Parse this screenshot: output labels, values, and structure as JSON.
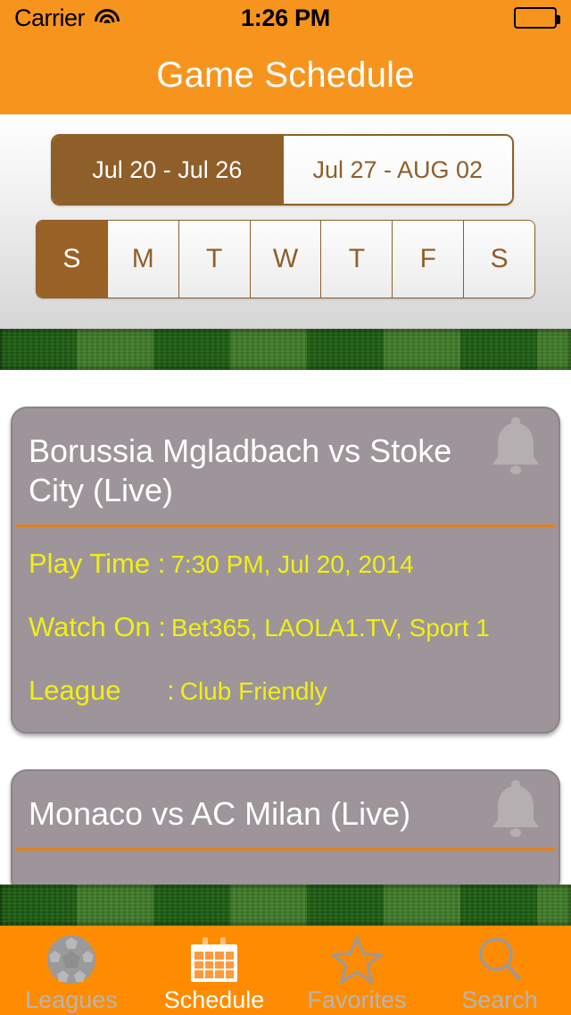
{
  "statusbar": {
    "carrier": "Carrier",
    "time": "1:26 PM",
    "wifi_icon": "wifi-icon",
    "battery_icon": "battery-full-icon"
  },
  "navbar": {
    "title": "Game Schedule"
  },
  "week_selector": {
    "options": [
      {
        "label": "Jul 20 - Jul 26",
        "selected": true
      },
      {
        "label": "Jul 27 - AUG 02",
        "selected": false
      }
    ]
  },
  "day_selector": {
    "days": [
      {
        "label": "S",
        "selected": true
      },
      {
        "label": "M",
        "selected": false
      },
      {
        "label": "T",
        "selected": false
      },
      {
        "label": "W",
        "selected": false
      },
      {
        "label": "T",
        "selected": false
      },
      {
        "label": "F",
        "selected": false
      },
      {
        "label": "S",
        "selected": false
      }
    ]
  },
  "games": [
    {
      "title": "Borussia Mgladbach vs Stoke City (Live)",
      "alarm_icon": "bell-icon",
      "play_time_label": "Play Time :",
      "play_time_value": "7:30 PM, Jul 20, 2014",
      "watch_on_label": "Watch On :",
      "watch_on_value": "Bet365, LAOLA1.TV, Sport 1",
      "league_label": "League      :",
      "league_value": "Club Friendly"
    },
    {
      "title": "Monaco vs AC Milan (Live)",
      "alarm_icon": "bell-icon"
    }
  ],
  "tabbar": {
    "items": [
      {
        "label": "Leagues",
        "icon": "soccer-ball-icon",
        "active": false
      },
      {
        "label": "Schedule",
        "icon": "calendar-icon",
        "active": true
      },
      {
        "label": "Favorites",
        "icon": "star-icon",
        "active": false
      },
      {
        "label": "Search",
        "icon": "magnifier-icon",
        "active": false
      }
    ]
  },
  "colors": {
    "accent_orange": "#F7941E",
    "tabbar_orange": "#FF8C00",
    "brown": "#8F5F29",
    "card_bg": "#9D9599",
    "card_text": "#FFFFFF",
    "detail_yellow": "#F2EF15",
    "divider_orange": "#E0801E",
    "grass_dark": "#1D5C12",
    "grass_light": "#3F7A28"
  }
}
